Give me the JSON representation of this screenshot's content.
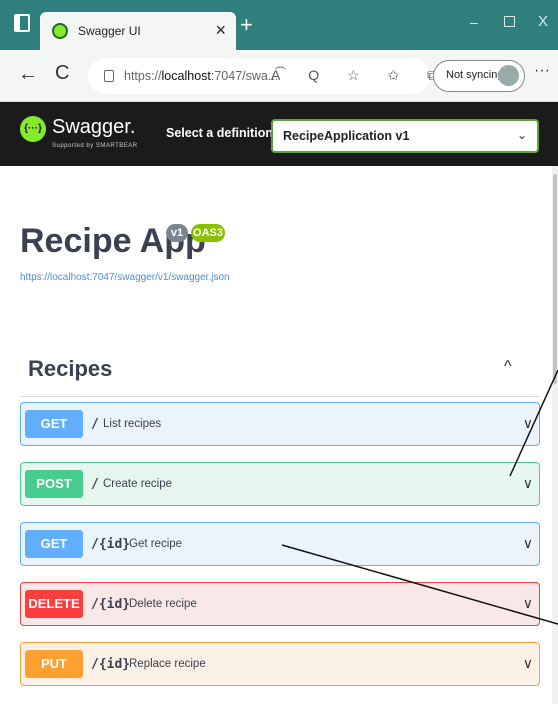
{
  "browser": {
    "tab_title": "Swagger UI",
    "tab_close": "×",
    "new_tab": "+",
    "window_controls": {
      "minimize": "–",
      "close": "X"
    },
    "url_prefix": "https://",
    "url_host": "localhost",
    "url_rest": ":7047/swa...",
    "url_icons": "A͡ Q ☆ ✩ ⧉",
    "sync_label": "Not syncing",
    "more": "···",
    "back": "←",
    "refresh": "C"
  },
  "swagger": {
    "logo_text": "{···}",
    "name": "Swagger.",
    "sub": "Supported by SMARTBEAR",
    "select_label": "Select a definition",
    "select_value": "RecipeApplication v1",
    "select_chevron": "⌄"
  },
  "info": {
    "title": "Recipe App",
    "version_badge": "v1",
    "oas_badge": "OAS3",
    "spec_url": "https://localhost:7047/swagger/v1/swagger.json"
  },
  "section": {
    "name": "Recipes",
    "toggle": "^"
  },
  "operations": [
    {
      "method": "GET",
      "path": "/",
      "summary": "List recipes",
      "chevron": "∨"
    },
    {
      "method": "POST",
      "path": "/",
      "summary": "Create recipe",
      "chevron": "∨"
    },
    {
      "method": "GET",
      "path": "/{id}",
      "summary": "Get recipe",
      "chevron": "∨"
    },
    {
      "method": "DELETE",
      "path": "/{id}",
      "summary": "Delete recipe",
      "chevron": "∨"
    },
    {
      "method": "PUT",
      "path": "/{id}",
      "summary": "Replace recipe",
      "chevron": "∨"
    }
  ],
  "colors": {
    "titlebar": "#2f7f7f",
    "get": "#61affe",
    "post": "#49cc90",
    "delete": "#f93e3e",
    "put": "#fca130",
    "swagger_bar": "#1b1b1b"
  },
  "icons": {
    "window": "window-icon",
    "favicon": "swagger-favicon-icon",
    "lock": "lock-icon",
    "avatar": "profile-avatar-icon"
  }
}
